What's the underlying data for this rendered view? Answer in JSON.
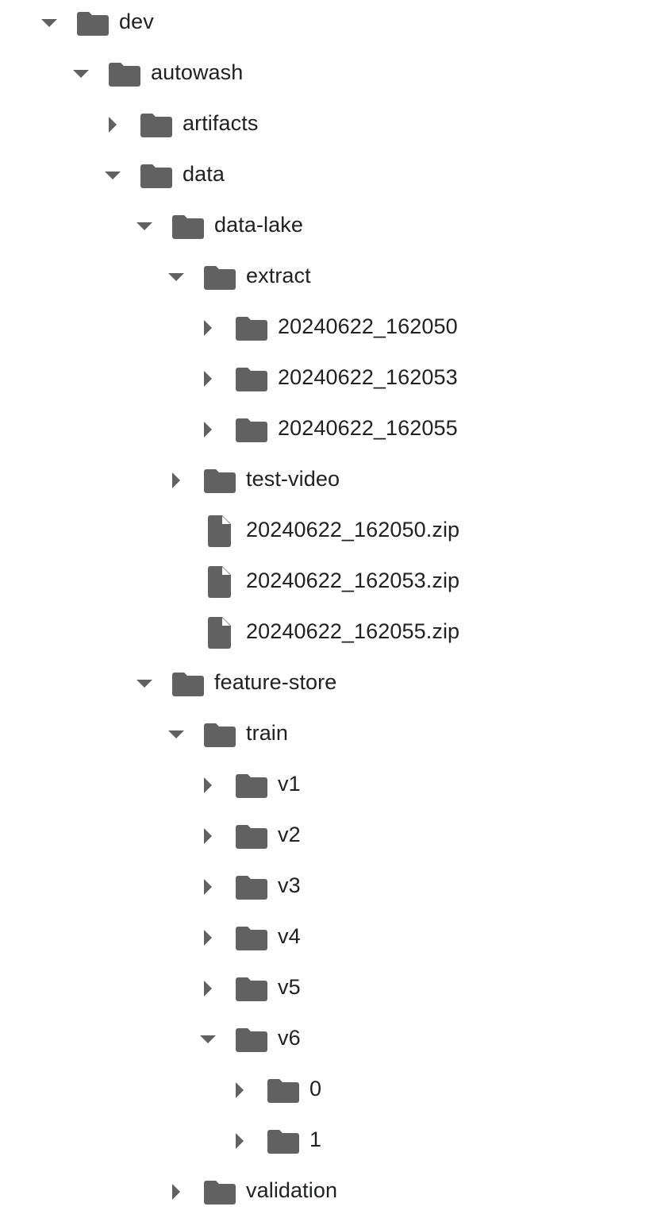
{
  "tree": {
    "colors": {
      "icon": "#616161",
      "text": "#202124"
    },
    "items": [
      {
        "name": "dev",
        "type": "folder",
        "depth": 0,
        "expanded": true,
        "icon": "folder-icon"
      },
      {
        "name": "autowash",
        "type": "folder",
        "depth": 1,
        "expanded": true,
        "icon": "folder-icon"
      },
      {
        "name": "artifacts",
        "type": "folder",
        "depth": 2,
        "expanded": false,
        "icon": "folder-icon"
      },
      {
        "name": "data",
        "type": "folder",
        "depth": 2,
        "expanded": true,
        "icon": "folder-icon"
      },
      {
        "name": "data-lake",
        "type": "folder",
        "depth": 3,
        "expanded": true,
        "icon": "folder-icon"
      },
      {
        "name": "extract",
        "type": "folder",
        "depth": 4,
        "expanded": true,
        "icon": "folder-icon"
      },
      {
        "name": "20240622_162050",
        "type": "folder",
        "depth": 5,
        "expanded": false,
        "icon": "folder-icon"
      },
      {
        "name": "20240622_162053",
        "type": "folder",
        "depth": 5,
        "expanded": false,
        "icon": "folder-icon"
      },
      {
        "name": "20240622_162055",
        "type": "folder",
        "depth": 5,
        "expanded": false,
        "icon": "folder-icon"
      },
      {
        "name": "test-video",
        "type": "folder",
        "depth": 4,
        "expanded": false,
        "icon": "folder-icon"
      },
      {
        "name": "20240622_162050.zip",
        "type": "file",
        "depth": 4,
        "icon": "file-icon"
      },
      {
        "name": "20240622_162053.zip",
        "type": "file",
        "depth": 4,
        "icon": "file-icon"
      },
      {
        "name": "20240622_162055.zip",
        "type": "file",
        "depth": 4,
        "icon": "file-icon"
      },
      {
        "name": "feature-store",
        "type": "folder",
        "depth": 3,
        "expanded": true,
        "icon": "folder-icon"
      },
      {
        "name": "train",
        "type": "folder",
        "depth": 4,
        "expanded": true,
        "icon": "folder-icon"
      },
      {
        "name": "v1",
        "type": "folder",
        "depth": 5,
        "expanded": false,
        "icon": "folder-icon"
      },
      {
        "name": "v2",
        "type": "folder",
        "depth": 5,
        "expanded": false,
        "icon": "folder-icon"
      },
      {
        "name": "v3",
        "type": "folder",
        "depth": 5,
        "expanded": false,
        "icon": "folder-icon"
      },
      {
        "name": "v4",
        "type": "folder",
        "depth": 5,
        "expanded": false,
        "icon": "folder-icon"
      },
      {
        "name": "v5",
        "type": "folder",
        "depth": 5,
        "expanded": false,
        "icon": "folder-icon"
      },
      {
        "name": "v6",
        "type": "folder",
        "depth": 5,
        "expanded": true,
        "icon": "folder-icon"
      },
      {
        "name": "0",
        "type": "folder",
        "depth": 6,
        "expanded": false,
        "icon": "folder-icon"
      },
      {
        "name": "1",
        "type": "folder",
        "depth": 6,
        "expanded": false,
        "icon": "folder-icon"
      },
      {
        "name": "validation",
        "type": "folder",
        "depth": 4,
        "expanded": false,
        "icon": "folder-icon"
      }
    ]
  }
}
